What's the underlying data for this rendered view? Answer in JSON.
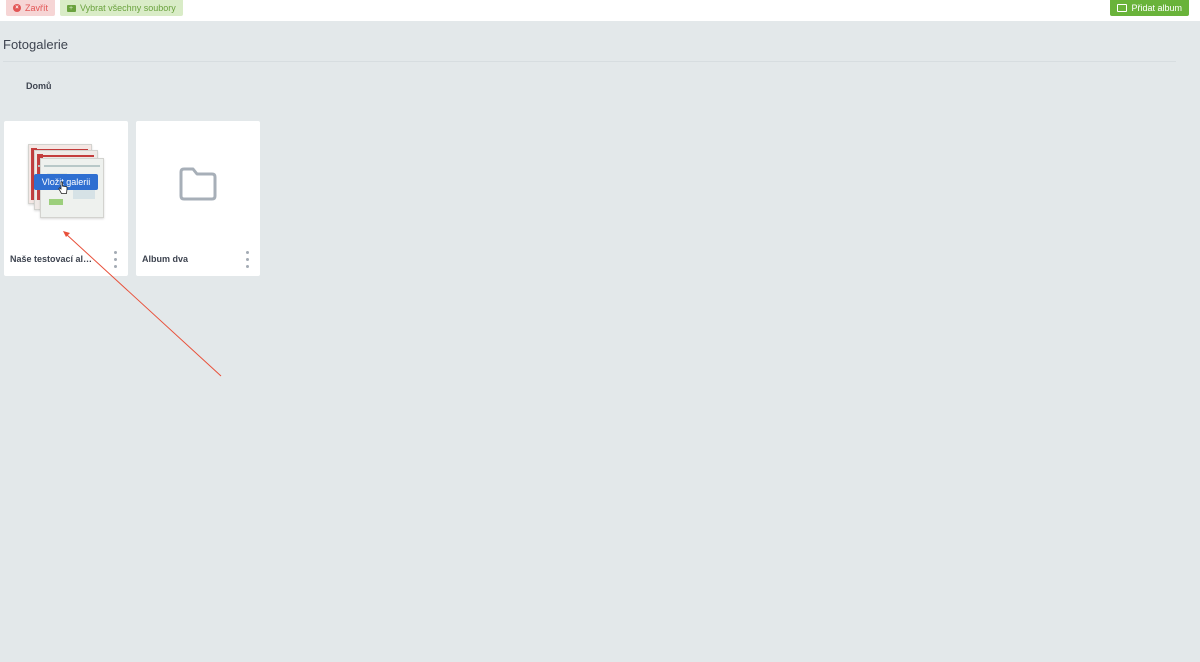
{
  "toolbar": {
    "close_label": "Zavřít",
    "select_all_label": "Vybrat všechny soubory",
    "add_album_label": "Přidat album"
  },
  "page": {
    "title": "Fotogalerie",
    "breadcrumb": "Domů"
  },
  "albums": [
    {
      "label": "Naše testovací al…",
      "overlay_button": "Vložit galerii",
      "has_thumbnails": true
    },
    {
      "label": "Album dva",
      "has_thumbnails": false
    }
  ],
  "colors": {
    "background": "#e3e8ea",
    "close_bg": "#f6d5d5",
    "close_text": "#e25555",
    "select_bg": "#d9ecc7",
    "select_text": "#6aa23e",
    "add_bg": "#69b33a",
    "insert_bg": "#2f6fd1",
    "annotation_arrow": "#e8503a"
  },
  "icons": {
    "close": "close-circle-icon",
    "select_all": "folder-plus-icon",
    "add_album": "folder-outline-icon",
    "album_empty": "folder-icon",
    "menu": "kebab-menu-icon",
    "cursor": "hand-pointer-icon"
  }
}
